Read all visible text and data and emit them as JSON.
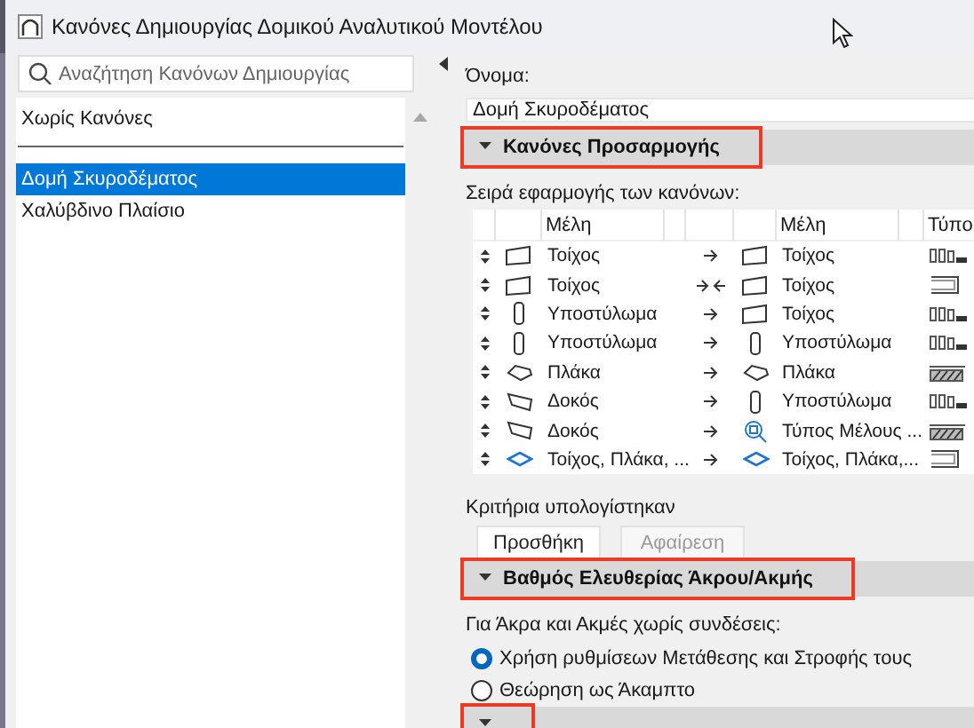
{
  "window": {
    "title": "Κανόνες Δημιουργίας Δομικού Αναλυτικού Μοντέλου"
  },
  "search": {
    "placeholder": "Αναζήτηση Κανόνων Δημιουργίας"
  },
  "default_item": {
    "label": "Χωρίς Κανόνες",
    "selected": false
  },
  "rule_sets": [
    {
      "label": "Δομή Σκυροδέματος",
      "selected": true
    },
    {
      "label": "Χαλύβδινο Πλαίσιο",
      "selected": false
    }
  ],
  "name_field": {
    "label": "Όνομα:",
    "value": "Δομή Σκυροδέματος"
  },
  "adjustment_section": {
    "title": "Κανόνες Προσαρμογής",
    "expanded": true,
    "highlighted": true,
    "order_label": "Σειρά εφαρμογής των κανόνων:",
    "columns": [
      "Μέλη",
      "Μέλη",
      "Τύπο"
    ],
    "rows": [
      {
        "source": {
          "kind": "wall",
          "label": "Τοίχος"
        },
        "link": {
          "kind": "one_way"
        },
        "target": {
          "kind": "wall",
          "label": "Τοίχος"
        },
        "type": {
          "kind": "gaps"
        }
      },
      {
        "source": {
          "kind": "wall",
          "label": "Τοίχος"
        },
        "link": {
          "kind": "both_ways"
        },
        "target": {
          "kind": "wall",
          "label": "Τοίχος"
        },
        "type": {
          "kind": "bracket"
        }
      },
      {
        "source": {
          "kind": "column",
          "label": "Υποστύλωμα"
        },
        "link": {
          "kind": "one_way"
        },
        "target": {
          "kind": "wall",
          "label": "Τοίχος"
        },
        "type": {
          "kind": "gaps"
        }
      },
      {
        "source": {
          "kind": "column",
          "label": "Υποστύλωμα"
        },
        "link": {
          "kind": "one_way"
        },
        "target": {
          "kind": "column",
          "label": "Υποστύλωμα"
        },
        "type": {
          "kind": "gaps"
        }
      },
      {
        "source": {
          "kind": "slab",
          "label": "Πλάκα"
        },
        "link": {
          "kind": "one_way"
        },
        "target": {
          "kind": "slab",
          "label": "Πλάκα"
        },
        "type": {
          "kind": "hatch"
        }
      },
      {
        "source": {
          "kind": "beam",
          "label": "Δοκός"
        },
        "link": {
          "kind": "one_way"
        },
        "target": {
          "kind": "column",
          "label": "Υποστύλωμα"
        },
        "type": {
          "kind": "gaps"
        }
      },
      {
        "source": {
          "kind": "beam",
          "label": "Δοκός"
        },
        "link": {
          "kind": "one_way"
        },
        "target": {
          "kind": "member_type",
          "label": "Τύπος Μέλους ..."
        },
        "type": {
          "kind": "hatch"
        }
      },
      {
        "source": {
          "kind": "mixed",
          "label": "Τοίχος, Πλάκα, ..."
        },
        "link": {
          "kind": "one_way"
        },
        "target": {
          "kind": "mixed",
          "label": "Τοίχος, Πλάκα,..."
        },
        "type": {
          "kind": "bracket"
        }
      }
    ],
    "criteria_label": "Κριτήρια υπολογίστηκαν",
    "buttons": [
      {
        "label": "Προσθήκη",
        "disabled": false
      },
      {
        "label": "Αφαίρεση",
        "disabled": true
      }
    ]
  },
  "freedom_section": {
    "title": "Βαθμός Ελευθερίας Άκρου/Ακμής",
    "expanded": true,
    "highlighted": true,
    "description": "Για Άκρα και Ακμές χωρίς συνδέσεις:",
    "options": [
      {
        "label": "Χρήση ρυθμίσεων Μετάθεσης και Στροφής τους",
        "selected": true
      },
      {
        "label": "Θεώρηση ως Άκαμπτο",
        "selected": false
      }
    ]
  },
  "third_section": {
    "expanded": true,
    "highlighted": true
  }
}
